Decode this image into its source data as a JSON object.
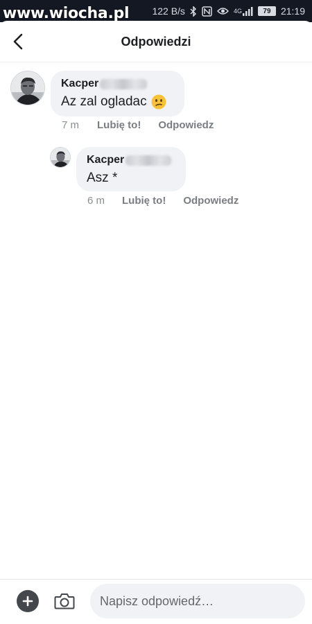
{
  "status_bar": {
    "watermark": "www.wiocha.pl",
    "network_speed": "122 B/s",
    "network_type": "4G",
    "battery": "79",
    "time": "21:19",
    "icons": [
      "bluetooth-icon",
      "nfc-icon",
      "eye-icon",
      "signal-icon",
      "battery-icon"
    ]
  },
  "header": {
    "title": "Odpowiedzi",
    "back_icon": "chevron-left-icon"
  },
  "comments": [
    {
      "author": "Kacper",
      "text": "Az zal ogladac",
      "emoji": "confused-face",
      "time": "7 m",
      "like_label": "Lubię to!",
      "reply_label": "Odpowiedz"
    },
    {
      "author": "Kacper",
      "text": "Asz *",
      "time": "6 m",
      "like_label": "Lubię to!",
      "reply_label": "Odpowiedz"
    }
  ],
  "composer": {
    "placeholder": "Napisz odpowiedź…",
    "plus_icon": "plus-circle-icon",
    "camera_icon": "camera-icon"
  },
  "colors": {
    "status_bar_bg": "#141823",
    "bubble_bg": "#f0f2f5",
    "text_primary": "#1c1e21",
    "text_secondary": "#8a8d91"
  }
}
